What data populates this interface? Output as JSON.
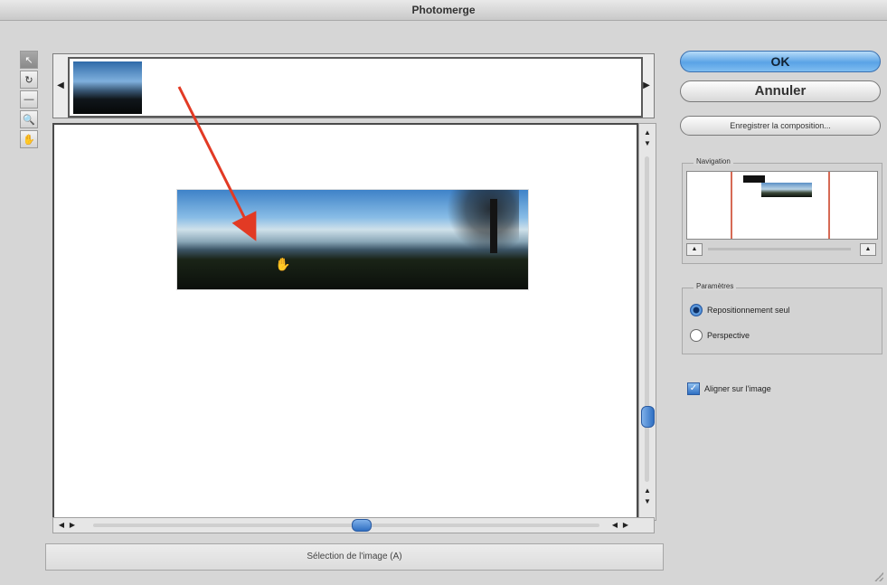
{
  "window": {
    "title": "Photomerge"
  },
  "tools": [
    {
      "name": "select-tool",
      "glyph": "↖"
    },
    {
      "name": "rotate-tool",
      "glyph": "↻"
    },
    {
      "name": "vanishing-point-tool",
      "glyph": "—"
    },
    {
      "name": "zoom-tool",
      "glyph": "🔍"
    },
    {
      "name": "hand-tool",
      "glyph": "✋"
    }
  ],
  "filmstrip": {
    "left_arrow": "◀",
    "right_arrow": "▶"
  },
  "status": {
    "text": "Sélection de l'image (A)"
  },
  "buttons": {
    "ok": "OK",
    "cancel": "Annuler",
    "save": "Enregistrer la composition..."
  },
  "navigation": {
    "label": "Navigation",
    "zoom_out": "▲",
    "zoom_in": "▲"
  },
  "parameters": {
    "label": "Paramètres",
    "options": [
      {
        "label": "Repositionnement seul",
        "selected": true
      },
      {
        "label": "Perspective",
        "selected": false
      }
    ]
  },
  "snap": {
    "label": "Aligner sur l'image",
    "checked": true
  },
  "accent": {
    "button_blue": "#5aa3e6",
    "annotation_red": "#e23a24"
  }
}
